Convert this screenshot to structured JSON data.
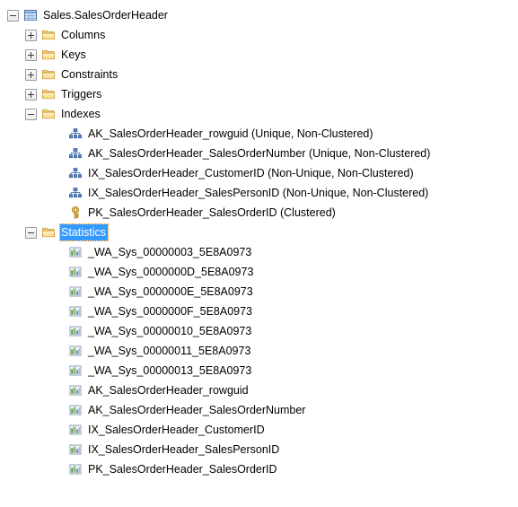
{
  "tree": {
    "root": {
      "label": "Sales.SalesOrderHeader",
      "icon": "table-icon",
      "expander": "minus"
    },
    "folders": [
      {
        "label": "Columns",
        "icon": "folder-icon",
        "expander": "plus"
      },
      {
        "label": "Keys",
        "icon": "folder-icon",
        "expander": "plus"
      },
      {
        "label": "Constraints",
        "icon": "folder-icon",
        "expander": "plus"
      },
      {
        "label": "Triggers",
        "icon": "folder-icon",
        "expander": "plus"
      },
      {
        "label": "Indexes",
        "icon": "folder-icon",
        "expander": "minus"
      }
    ],
    "indexes": [
      {
        "label": "AK_SalesOrderHeader_rowguid (Unique, Non-Clustered)",
        "icon": "index-icon"
      },
      {
        "label": "AK_SalesOrderHeader_SalesOrderNumber (Unique, Non-Clustered)",
        "icon": "index-icon"
      },
      {
        "label": "IX_SalesOrderHeader_CustomerID (Non-Unique, Non-Clustered)",
        "icon": "index-icon"
      },
      {
        "label": "IX_SalesOrderHeader_SalesPersonID (Non-Unique, Non-Clustered)",
        "icon": "index-icon"
      },
      {
        "label": "PK_SalesOrderHeader_SalesOrderID (Clustered)",
        "icon": "key-icon"
      }
    ],
    "statistics_folder": {
      "label": "Statistics",
      "icon": "folder-icon",
      "expander": "minus",
      "selected": true
    },
    "statistics": [
      {
        "label": "_WA_Sys_00000003_5E8A0973",
        "icon": "statistics-icon"
      },
      {
        "label": "_WA_Sys_0000000D_5E8A0973",
        "icon": "statistics-icon"
      },
      {
        "label": "_WA_Sys_0000000E_5E8A0973",
        "icon": "statistics-icon"
      },
      {
        "label": "_WA_Sys_0000000F_5E8A0973",
        "icon": "statistics-icon"
      },
      {
        "label": "_WA_Sys_00000010_5E8A0973",
        "icon": "statistics-icon"
      },
      {
        "label": "_WA_Sys_00000011_5E8A0973",
        "icon": "statistics-icon"
      },
      {
        "label": "_WA_Sys_00000013_5E8A0973",
        "icon": "statistics-icon"
      },
      {
        "label": "AK_SalesOrderHeader_rowguid",
        "icon": "statistics-icon"
      },
      {
        "label": "AK_SalesOrderHeader_SalesOrderNumber",
        "icon": "statistics-icon"
      },
      {
        "label": "IX_SalesOrderHeader_CustomerID",
        "icon": "statistics-icon"
      },
      {
        "label": "IX_SalesOrderHeader_SalesPersonID",
        "icon": "statistics-icon"
      },
      {
        "label": "PK_SalesOrderHeader_SalesOrderID",
        "icon": "statistics-icon"
      }
    ]
  },
  "colors": {
    "selection": "#3399ff",
    "focus_outline": "#e08000",
    "folder": "#f5c242",
    "table_header": "#4a7ebb",
    "index_node": "#3f6fb5",
    "key": "#e8b63a",
    "stat_bar_green": "#5ba33a",
    "stat_bar_blue": "#7f93c8",
    "background": "#ffffff",
    "text": "#000000"
  }
}
